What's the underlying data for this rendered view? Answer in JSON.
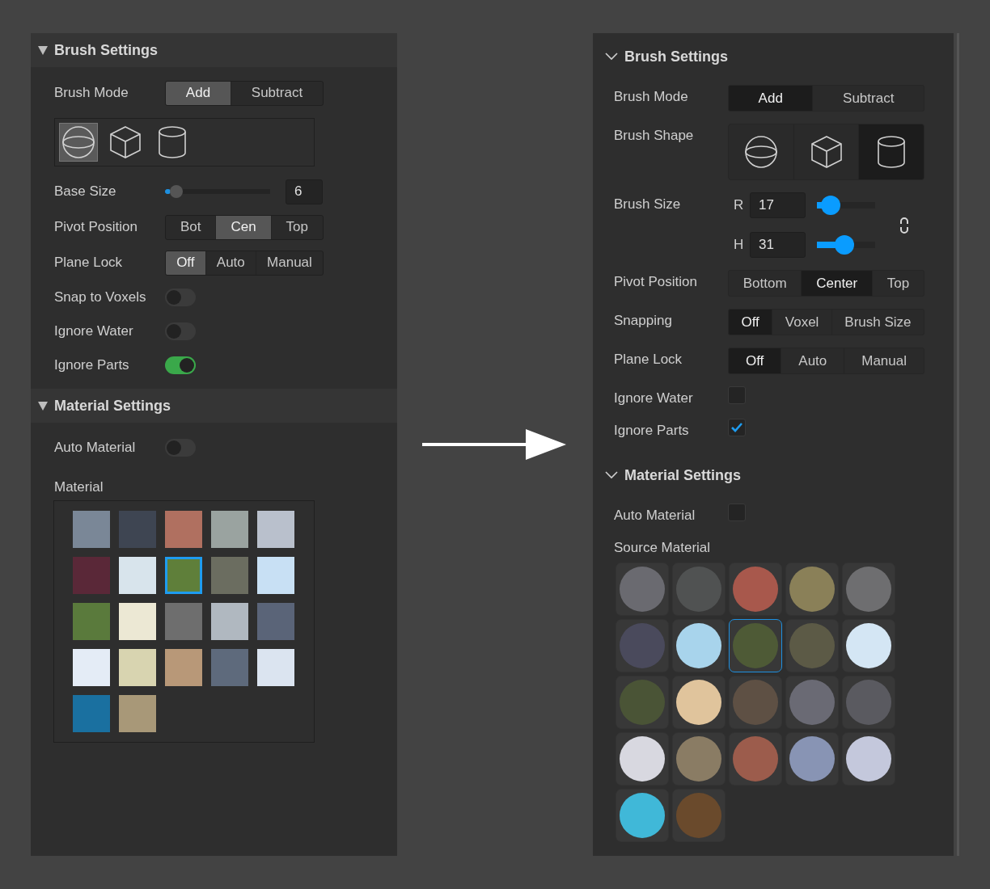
{
  "panels": [
    {
      "kind": "classic",
      "sections": [
        {
          "title": "Brush Settings",
          "expanded": true,
          "rows": [
            {
              "kind": "segmented",
              "label": "Brush Mode",
              "options": [
                {
                  "label": "Add",
                  "selected": true
                },
                {
                  "label": "Subtract",
                  "selected": false
                }
              ]
            },
            {
              "kind": "shapes",
              "shapes": [
                {
                  "kind": "sphere",
                  "selected": true
                },
                {
                  "kind": "cube",
                  "selected": false
                },
                {
                  "kind": "cylinder",
                  "selected": false
                }
              ]
            },
            {
              "kind": "slider",
              "label": "Base Size",
              "level": 0.05,
              "value": "6"
            },
            {
              "kind": "segmented",
              "label": "Pivot Position",
              "options": [
                {
                  "label": "Bot",
                  "selected": false
                },
                {
                  "label": "Cen",
                  "selected": true
                },
                {
                  "label": "Top",
                  "selected": false
                }
              ]
            },
            {
              "kind": "segmented",
              "label": "Plane Lock",
              "options": [
                {
                  "label": "Off",
                  "selected": true
                },
                {
                  "label": "Auto",
                  "selected": false
                },
                {
                  "label": "Manual",
                  "selected": false
                }
              ]
            },
            {
              "kind": "toggle",
              "label": "Snap to Voxels",
              "on": false
            },
            {
              "kind": "toggle",
              "label": "Ignore Water",
              "on": false
            },
            {
              "kind": "toggle",
              "label": "Ignore Parts",
              "on": true
            }
          ]
        },
        {
          "title": "Material Settings",
          "expanded": true,
          "rows": [
            {
              "kind": "toggle",
              "label": "Auto Material",
              "on": false
            },
            {
              "kind": "materials",
              "label": "Material",
              "swatches": [
                {
                  "color": "#7a8797",
                  "selected": false
                },
                {
                  "color": "#3e4552",
                  "selected": false
                },
                {
                  "color": "#b07060",
                  "selected": false
                },
                {
                  "color": "#9aa3a0",
                  "selected": false
                },
                {
                  "color": "#b9c0cc",
                  "selected": false
                },
                {
                  "color": "#5a2838",
                  "selected": false
                },
                {
                  "color": "#d8e4ec",
                  "selected": false
                },
                {
                  "color": "#5f7f3a",
                  "selected": true
                },
                {
                  "color": "#6b6d60",
                  "selected": false
                },
                {
                  "color": "#c8e0f4",
                  "selected": false
                },
                {
                  "color": "#5a7a3c",
                  "selected": false
                },
                {
                  "color": "#ece8d4",
                  "selected": false
                },
                {
                  "color": "#6e6e6e",
                  "selected": false
                },
                {
                  "color": "#b0b8c0",
                  "selected": false
                },
                {
                  "color": "#5a6478",
                  "selected": false
                },
                {
                  "color": "#e4ecf6",
                  "selected": false
                },
                {
                  "color": "#d8d4b0",
                  "selected": false
                },
                {
                  "color": "#b89878",
                  "selected": false
                },
                {
                  "color": "#5e6a7c",
                  "selected": false
                },
                {
                  "color": "#dbe4f0",
                  "selected": false
                },
                {
                  "color": "#1a70a0",
                  "selected": false
                },
                {
                  "color": "#a89878",
                  "selected": false
                }
              ]
            }
          ]
        }
      ]
    },
    {
      "kind": "modern",
      "sections": [
        {
          "title": "Brush Settings",
          "expanded": true,
          "rows": [
            {
              "kind": "segmented",
              "label": "Brush Mode",
              "options": [
                {
                  "label": "Add",
                  "selected": true
                },
                {
                  "label": "Subtract",
                  "selected": false
                }
              ]
            },
            {
              "kind": "shapes",
              "label": "Brush Shape",
              "shapes": [
                {
                  "kind": "sphere",
                  "selected": false
                },
                {
                  "kind": "cube",
                  "selected": false
                },
                {
                  "kind": "cylinder",
                  "selected": true
                }
              ]
            },
            {
              "kind": "size",
              "label": "Brush Size",
              "sliders": [
                {
                  "axis": "R",
                  "value": "17",
                  "level": 0.1
                },
                {
                  "axis": "H",
                  "value": "31",
                  "level": 0.45
                }
              ]
            },
            {
              "kind": "segmented",
              "label": "Pivot Position",
              "options": [
                {
                  "label": "Bottom",
                  "selected": false
                },
                {
                  "label": "Center",
                  "selected": true
                },
                {
                  "label": "Top",
                  "selected": false
                }
              ]
            },
            {
              "kind": "segmented",
              "label": "Snapping",
              "options": [
                {
                  "label": "Off",
                  "selected": true
                },
                {
                  "label": "Voxel",
                  "selected": false
                },
                {
                  "label": "Brush Size",
                  "selected": false
                }
              ]
            },
            {
              "kind": "segmented",
              "label": "Plane Lock",
              "options": [
                {
                  "label": "Off",
                  "selected": true
                },
                {
                  "label": "Auto",
                  "selected": false
                },
                {
                  "label": "Manual",
                  "selected": false
                }
              ]
            },
            {
              "kind": "checkbox",
              "label": "Ignore Water",
              "checked": false
            },
            {
              "kind": "checkbox",
              "label": "Ignore Parts",
              "checked": true
            }
          ]
        },
        {
          "title": "Material Settings",
          "expanded": true,
          "rows": [
            {
              "kind": "checkbox",
              "label": "Auto Material",
              "checked": false
            },
            {
              "kind": "materials",
              "label": "Source Material",
              "swatches": [
                {
                  "color": "#6a6a70",
                  "selected": false
                },
                {
                  "color": "#505252",
                  "selected": false
                },
                {
                  "color": "#a8584c",
                  "selected": false
                },
                {
                  "color": "#8a8058",
                  "selected": false
                },
                {
                  "color": "#6e6e70",
                  "selected": false
                },
                {
                  "color": "#4a4a5c",
                  "selected": false
                },
                {
                  "color": "#a8d4ec",
                  "selected": false
                },
                {
                  "color": "#4e5a36",
                  "selected": true
                },
                {
                  "color": "#5c5a46",
                  "selected": false
                },
                {
                  "color": "#d4e6f4",
                  "selected": false
                },
                {
                  "color": "#4a5436",
                  "selected": false
                },
                {
                  "color": "#e0c49c",
                  "selected": false
                },
                {
                  "color": "#5e5044",
                  "selected": false
                },
                {
                  "color": "#6a6a74",
                  "selected": false
                },
                {
                  "color": "#5a5a60",
                  "selected": false
                },
                {
                  "color": "#d8d8e0",
                  "selected": false
                },
                {
                  "color": "#8a7c64",
                  "selected": false
                },
                {
                  "color": "#9c5c4c",
                  "selected": false
                },
                {
                  "color": "#8894b4",
                  "selected": false
                },
                {
                  "color": "#c4c8dc",
                  "selected": false
                },
                {
                  "color": "#40b8d8",
                  "selected": false
                },
                {
                  "color": "#6a4a2c",
                  "selected": false
                }
              ]
            }
          ]
        }
      ]
    }
  ]
}
